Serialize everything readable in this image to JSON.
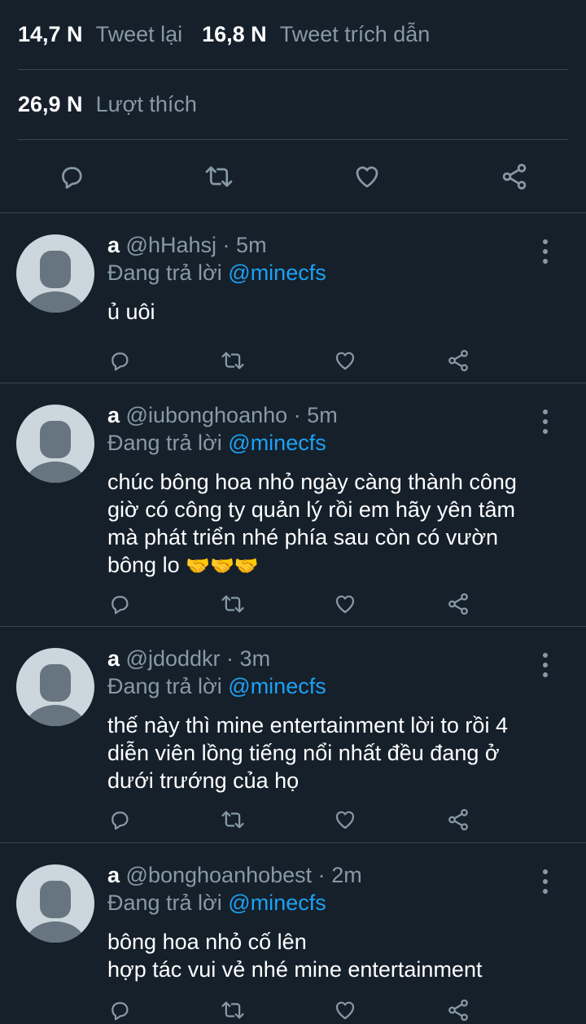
{
  "stats": {
    "retweets": {
      "count": "14,7 N",
      "label": "Tweet lại"
    },
    "quotes": {
      "count": "16,8 N",
      "label": "Tweet trích dẫn"
    },
    "likes": {
      "count": "26,9 N",
      "label": "Lượt thích"
    }
  },
  "main_actions": [
    "reply-icon",
    "retweet-icon",
    "like-icon",
    "share-icon"
  ],
  "replies": [
    {
      "name": "a",
      "handle": "@hHahsj",
      "dot": "·",
      "time": "5m",
      "replying_prefix": "Đang trả lời",
      "replying_to": "@minecfs",
      "text": "ủ uôi"
    },
    {
      "name": "a",
      "handle": "@iubonghoanho",
      "dot": "·",
      "time": "5m",
      "replying_prefix": "Đang trả lời",
      "replying_to": "@minecfs",
      "text": "chúc bông hoa nhỏ ngày càng thành công giờ có công ty quản lý rồi em hãy yên tâm mà phát triển nhé phía sau còn có vườn bông lo",
      "emoji": "🤝🤝🤝"
    },
    {
      "name": "a",
      "handle": "@jdoddkr",
      "dot": "·",
      "time": "3m",
      "replying_prefix": "Đang trả lời",
      "replying_to": "@minecfs",
      "text": "thế này thì mine entertainment lời to rồi 4 diễn viên lồng tiếng nổi nhất đều đang ở dưới trướng của họ"
    },
    {
      "name": "a",
      "handle": "@bonghoanhobest",
      "dot": "·",
      "time": "2m",
      "replying_prefix": "Đang trả lời",
      "replying_to": "@minecfs",
      "text": "bông hoa nhỏ cố lên\nhợp tác vui vẻ nhé mine entertainment"
    }
  ],
  "colors": {
    "background": "#15202b",
    "secondary_text": "#8899a6",
    "accent": "#1da1f2",
    "divider": "#38444d"
  }
}
